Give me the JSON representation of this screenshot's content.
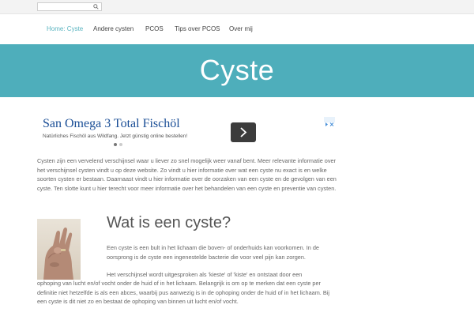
{
  "search": {
    "value": "",
    "placeholder": ""
  },
  "nav": {
    "items": [
      {
        "label": "Home: Cyste",
        "active": true
      },
      {
        "label": "Andere cysten"
      },
      {
        "label": "PCOS"
      },
      {
        "label": "Tips over PCOS"
      },
      {
        "label": "Over mij"
      }
    ]
  },
  "banner": {
    "title": "Cyste"
  },
  "ad": {
    "title": "San Omega 3 Total Fischöl",
    "subtitle": "Natürliches Fischöl aus Wildfang. Jetzt günstig online bestellen!"
  },
  "intro": {
    "text": "Cysten zijn een vervelend verschijnsel waar u liever zo snel mogelijk weer vanaf bent. Meer relevante informatie over het verschijnsel cysten vindt u op deze website. Zo vindt u hier informatie over wat een cyste nu exact is en welke soorten cysten er bestaan. Daarnaast vindt u hier informatie over de oorzaken van een cyste en de gevolgen van een cyste. Ten slotte kunt u hier terecht voor meer informatie over het behandelen van een cyste en preventie van cysten."
  },
  "section": {
    "heading": "Wat is een cyste?",
    "p1": "Een cyste is een bult in het lichaam die boven- of onderhuids kan voorkomen. In de oorsprong is de cyste  een ingenestelde bacterie die voor veel pijn kan zorgen.",
    "p2a": "Het verschijnsel wordt uitgesproken als 'kieste' of  'kiste' en ontstaat door een",
    "p2b": "ophoping van lucht en/of vocht onder de huid of in het lichaam. Belangrijk is om op te merken dat een cyste per definitie niet hetzelfde is als een abces, waarbij pus aanwezig is in de  ophoping onder de huid of in het lichaam. Bij een cyste is dit niet zo en bestaat de ophoping van binnen uit lucht en/of vocht."
  },
  "colors": {
    "accent": "#4eaebb",
    "active_nav": "#5ab4c0",
    "ad_title": "#1a4e96"
  }
}
